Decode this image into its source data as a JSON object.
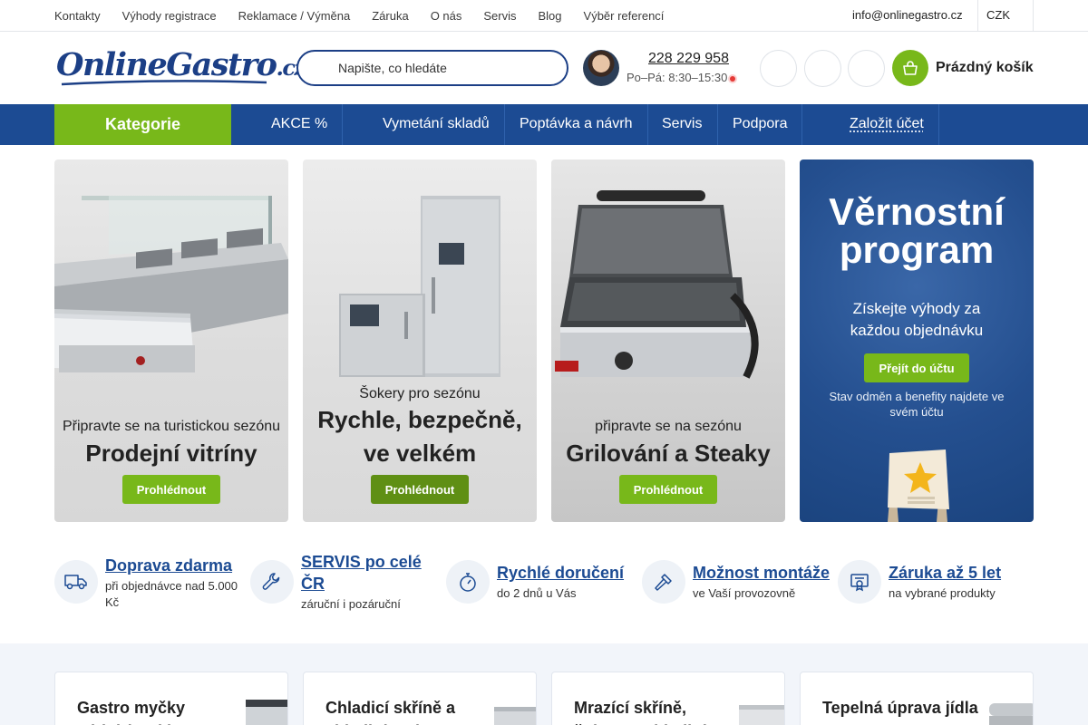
{
  "topbar": {
    "links": [
      "Kontakty",
      "Výhody registrace",
      "Reklamace / Výměna",
      "Záruka",
      "O nás",
      "Servis",
      "Blog",
      "Výběr referencí"
    ],
    "email": "info@onlinegastro.cz",
    "currency": "CZK"
  },
  "header": {
    "logo_main": "OnlineGastro",
    "logo_suffix": ".cz",
    "search_placeholder": "Napište, co hledáte",
    "phone": "228 229 958",
    "hours": "Po–Pá: 8:30–15:30",
    "cart_label": "Prázdný košík"
  },
  "nav": {
    "categories": "Kategorie",
    "items": [
      "AKCE %",
      "Vymetání skladů",
      "Poptávka a návrh",
      "Servis",
      "Podpora"
    ],
    "account": "Založit účet"
  },
  "promos": [
    {
      "pre": "Připravte se na turistickou sezónu",
      "headline": "Prodejní vitríny",
      "cta": "Prohlédnout"
    },
    {
      "pre": "Šokery pro sezónu",
      "headline": "Rychle, bezpečně, ve velkém",
      "cta": "Prohlédnout"
    },
    {
      "pre": "připravte se na sezónu",
      "headline": "Grilování a Steaky",
      "cta": "Prohlédnout"
    }
  ],
  "loyalty": {
    "title": "Věrnostní program",
    "subtitle": "Získejte výhody za každou objednávku",
    "cta": "Přejít do účtu",
    "note": "Stav odměn a benefity najdete ve svém účtu"
  },
  "benefits": [
    {
      "title": "Doprava zdarma",
      "sub": "při objednávce nad 5.000 Kč",
      "icon": "truck-icon"
    },
    {
      "title": "SERVIS po celé ČR",
      "sub": "záruční i pozáruční",
      "icon": "wrench-icon"
    },
    {
      "title": "Rychlé doručení",
      "sub": "do 2 dnů u Vás",
      "icon": "stopwatch-icon"
    },
    {
      "title": "Možnost montáže",
      "sub": "ve Vaší provozovně",
      "icon": "hammer-icon"
    },
    {
      "title": "Záruka až 5 let",
      "sub": "na vybrané produkty",
      "icon": "certificate-icon"
    }
  ],
  "categories": [
    {
      "title": "Gastro myčky nádobí a skla"
    },
    {
      "title": "Chladicí skříně a chladicí stoly"
    },
    {
      "title": "Mrazící skříně, šokery a chladicí"
    },
    {
      "title": "Tepelná úprava jídla"
    }
  ],
  "colors": {
    "brand_blue": "#1c4b93",
    "accent_green": "#78b81a",
    "logo_blue": "#1c3f86"
  }
}
